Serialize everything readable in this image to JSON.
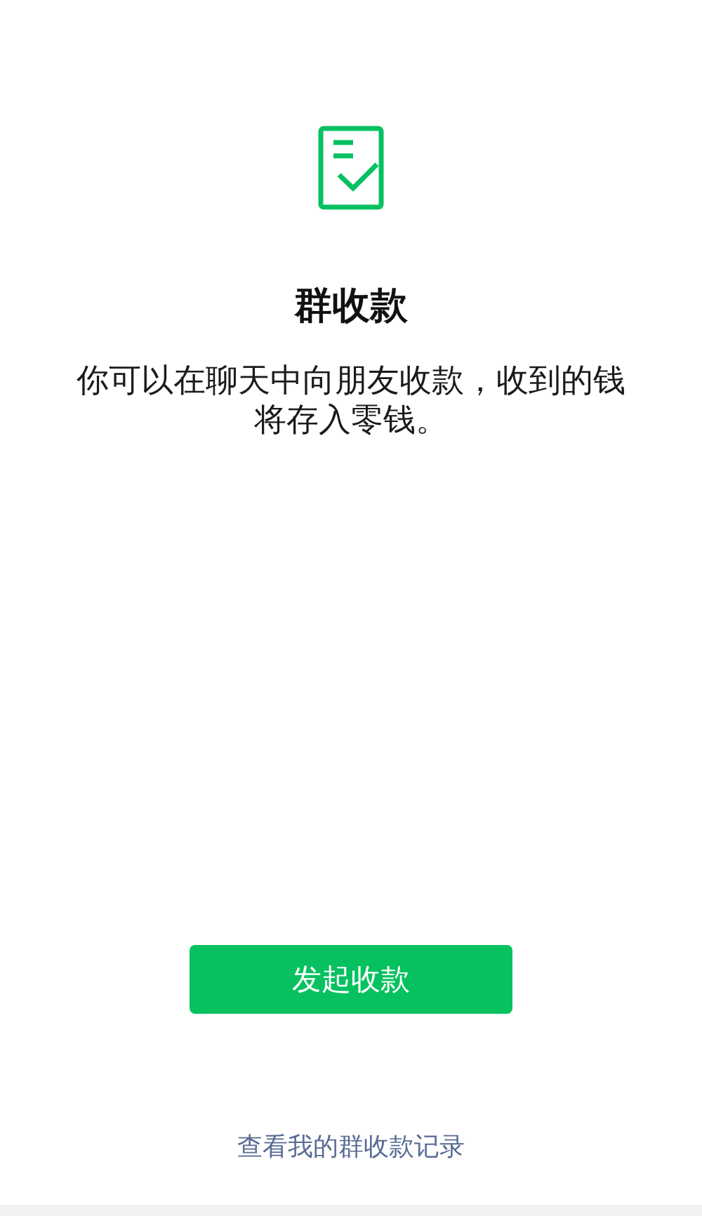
{
  "title": "群收款",
  "description": "你可以在聊天中向朋友收款，收到的钱将存入零钱。",
  "primary_button": {
    "label": "发起收款"
  },
  "link": {
    "label": "查看我的群收款记录"
  }
}
